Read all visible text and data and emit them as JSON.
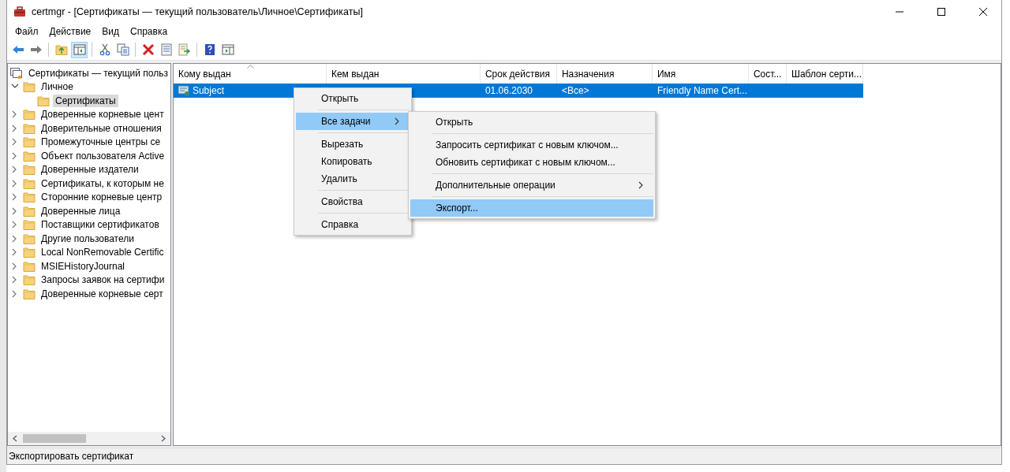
{
  "window": {
    "title": "certmgr - [Сертификаты — текущий пользователь\\Личное\\Сертификаты]"
  },
  "menu_bar": [
    {
      "label": "Файл"
    },
    {
      "label": "Действие"
    },
    {
      "label": "Вид"
    },
    {
      "label": "Справка"
    }
  ],
  "tree": {
    "label": "Сертификаты — текущий польз",
    "selected": false,
    "children": [
      {
        "label": "Личное",
        "expanded": true,
        "selected": false,
        "children": [
          {
            "label": "Сертификаты",
            "selected": true
          }
        ]
      },
      {
        "label": "Доверенные корневые цент",
        "expanded": false,
        "selected": false
      },
      {
        "label": "Доверительные отношения",
        "expanded": false,
        "selected": false
      },
      {
        "label": "Промежуточные центры се",
        "expanded": false,
        "selected": false
      },
      {
        "label": "Объект пользователя Active",
        "expanded": false,
        "selected": false
      },
      {
        "label": "Доверенные издатели",
        "expanded": false,
        "selected": false
      },
      {
        "label": "Сертификаты, к которым не",
        "expanded": false,
        "selected": false
      },
      {
        "label": "Сторонние корневые центр",
        "expanded": false,
        "selected": false
      },
      {
        "label": "Доверенные лица",
        "expanded": false,
        "selected": false
      },
      {
        "label": "Поставщики сертификатов",
        "expanded": false,
        "selected": false
      },
      {
        "label": "Другие пользователи",
        "expanded": false,
        "selected": false
      },
      {
        "label": "Local NonRemovable Certific",
        "expanded": false,
        "selected": false
      },
      {
        "label": "MSIEHistoryJournal",
        "expanded": false,
        "selected": false
      },
      {
        "label": "Запросы заявок на сертифи",
        "expanded": false,
        "selected": false
      },
      {
        "label": "Доверенные корневые серт",
        "expanded": false,
        "selected": false
      }
    ]
  },
  "table": {
    "columns": [
      "Кому выдан",
      "Кем выдан",
      "Срок действия",
      "Назначения",
      "Имя",
      "Сост...",
      "Шаблон серти..."
    ],
    "rows": [
      {
        "selected": true,
        "cells": [
          "Subject",
          "",
          "01.06.2030",
          "<Все>",
          "Friendly Name Cert...",
          "",
          ""
        ]
      }
    ]
  },
  "context_menu": {
    "items": [
      {
        "kind": "item",
        "label": "Открыть",
        "selected": false
      },
      {
        "kind": "separator"
      },
      {
        "kind": "submenu",
        "label": "Все задачи",
        "selected": true
      },
      {
        "kind": "separator"
      },
      {
        "kind": "item",
        "label": "Вырезать",
        "selected": false
      },
      {
        "kind": "item",
        "label": "Копировать",
        "selected": false
      },
      {
        "kind": "item",
        "label": "Удалить",
        "selected": false
      },
      {
        "kind": "separator"
      },
      {
        "kind": "item",
        "label": "Свойства",
        "selected": false
      },
      {
        "kind": "separator"
      },
      {
        "kind": "item",
        "label": "Справка",
        "selected": false
      }
    ]
  },
  "submenu": {
    "items": [
      {
        "kind": "item",
        "label": "Открыть",
        "selected": false
      },
      {
        "kind": "separator"
      },
      {
        "kind": "item",
        "label": "Запросить сертификат с новым ключом...",
        "selected": false
      },
      {
        "kind": "item",
        "label": "Обновить сертификат с новым ключом...",
        "selected": false
      },
      {
        "kind": "separator"
      },
      {
        "kind": "submenu",
        "label": "Дополнительные операции",
        "selected": false
      },
      {
        "kind": "separator"
      },
      {
        "kind": "item",
        "label": "Экспорт...",
        "selected": true
      }
    ]
  },
  "status_bar": {
    "text": "Экспортировать сертификат"
  }
}
